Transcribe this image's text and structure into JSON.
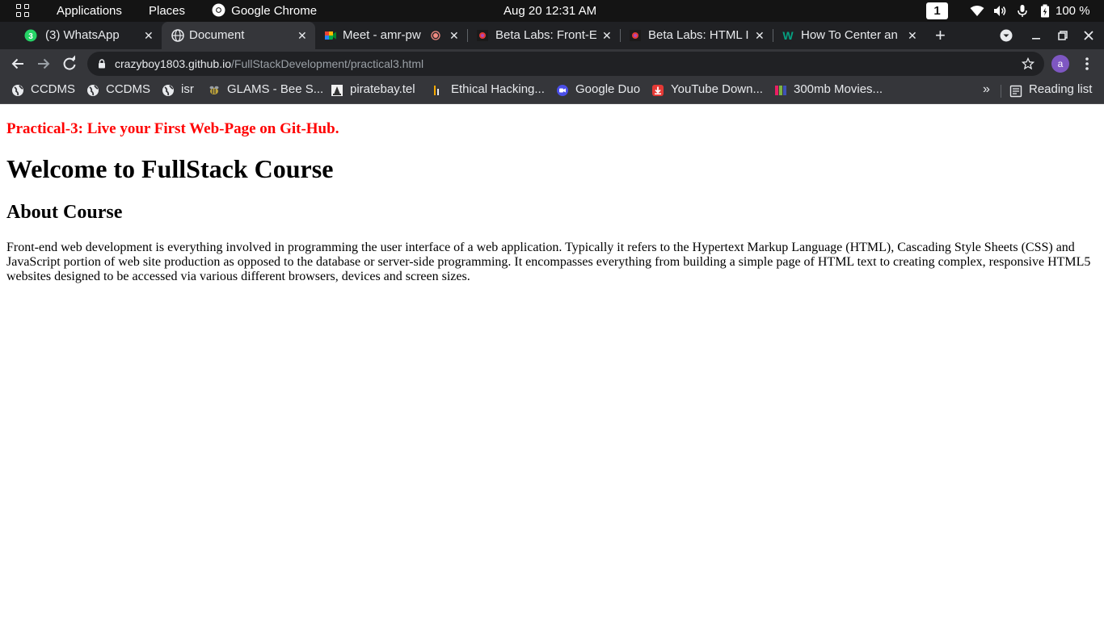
{
  "topbar": {
    "applications": "Applications",
    "places": "Places",
    "app_name": "Google Chrome",
    "datetime": "Aug 20  12:31 AM",
    "workspace": "1",
    "battery": "100 %"
  },
  "tabs": [
    {
      "title": "(3) WhatsApp",
      "favicon": "whatsapp-icon",
      "badge": "3"
    },
    {
      "title": "Document",
      "favicon": "globe-icon"
    },
    {
      "title": "Meet - amr-pw",
      "favicon": "meet-icon"
    },
    {
      "title": "Beta Labs: Front-E",
      "favicon": "betalabs-icon"
    },
    {
      "title": "Beta Labs: HTML I",
      "favicon": "betalabs-icon"
    },
    {
      "title": "How To Center an",
      "favicon": "w-icon"
    }
  ],
  "omnibox": {
    "host": "crazyboy1803.github.io",
    "path": "/FullStackDevelopment/practical3.html"
  },
  "profile": {
    "initial": "a"
  },
  "bookmarks": [
    {
      "label": "CCDMS",
      "icon": "globe-icon"
    },
    {
      "label": "CCDMS",
      "icon": "globe-icon"
    },
    {
      "label": "isr",
      "icon": "globe-icon"
    },
    {
      "label": "GLAMS - Bee S...",
      "icon": "bee-icon"
    },
    {
      "label": "piratebay.tel",
      "icon": "pirate-icon"
    },
    {
      "label": "Ethical Hacking...",
      "icon": "bars-icon"
    },
    {
      "label": "Google Duo",
      "icon": "duo-icon"
    },
    {
      "label": "YouTube Down...",
      "icon": "download-icon"
    },
    {
      "label": "300mb Movies...",
      "icon": "movies-icon"
    }
  ],
  "reading_list": "Reading list",
  "page": {
    "subtitle": "Practical-3: Live your First Web-Page on Git-Hub.",
    "heading": "Welcome to FullStack Course",
    "subheading": "About Course",
    "paragraph": "Front-end web development is everything involved in programming the user interface of a web application. Typically it refers to the Hypertext Markup Language (HTML), Cascading Style Sheets (CSS) and JavaScript portion of web site production as opposed to the database or server-side programming. It encompasses everything from building a simple page of HTML text to creating complex, responsive HTML5 websites designed to be accessed via various different browsers, devices and screen sizes."
  },
  "colors": {
    "topbar_bg": "#141414",
    "tabstrip_bg": "#202124",
    "toolbar_bg": "#35363a",
    "subtitle_red": "#ff0000",
    "avatar_purple": "#7e57c2"
  }
}
